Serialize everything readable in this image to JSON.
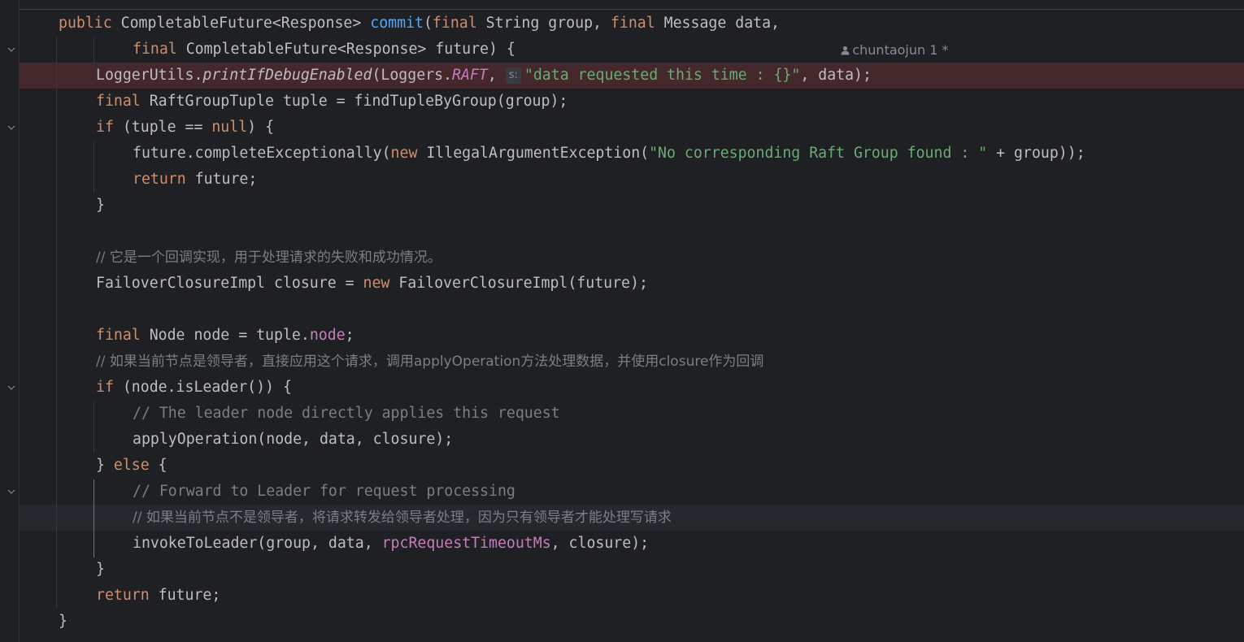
{
  "editor": {
    "author_annotation": "chuntaojun 1 *",
    "param_hint_label": "s:",
    "colors": {
      "background": "#1f2023",
      "keyword": "#cf8e6d",
      "method_declaration": "#56a8f5",
      "string": "#6aab73",
      "field": "#c77dbb",
      "comment": "#7a7e85",
      "breakpoint_line": "#45282b"
    },
    "icons": [
      "chevron-down-icon",
      "user-icon"
    ],
    "lines": [
      {
        "row": "0",
        "tokens": [
          {
            "text": "public ",
            "cls": "kw"
          },
          {
            "text": "CompletableFuture<Response> ",
            "cls": ""
          },
          {
            "text": "commit",
            "cls": "fn"
          },
          {
            "text": "(",
            "cls": ""
          },
          {
            "text": "final ",
            "cls": "kw"
          },
          {
            "text": "String group, ",
            "cls": ""
          },
          {
            "text": "final ",
            "cls": "kw"
          },
          {
            "text": "Message data,",
            "cls": ""
          }
        ]
      },
      {
        "row": "1",
        "tokens": [
          {
            "text": "final ",
            "cls": "kw"
          },
          {
            "text": "CompletableFuture<Response> future) {",
            "cls": ""
          }
        ]
      },
      {
        "row": "2",
        "tokens": [
          {
            "text": "LoggerUtils.",
            "cls": ""
          },
          {
            "text": "printIfDebugEnabled",
            "cls": "smeth"
          },
          {
            "text": "(Loggers.",
            "cls": ""
          },
          {
            "text": "RAFT",
            "cls": "sfld"
          },
          {
            "text": ", ",
            "cls": ""
          },
          {
            "text": "s:",
            "cls": "hint"
          },
          {
            "text": "\"data requested this time : {}\"",
            "cls": "str"
          },
          {
            "text": ", data);",
            "cls": ""
          }
        ]
      },
      {
        "row": "3",
        "tokens": [
          {
            "text": "final ",
            "cls": "kw"
          },
          {
            "text": "RaftGroupTuple tuple = findTupleByGroup(group);",
            "cls": ""
          }
        ]
      },
      {
        "row": "4",
        "tokens": [
          {
            "text": "if ",
            "cls": "kw"
          },
          {
            "text": "(tuple == ",
            "cls": ""
          },
          {
            "text": "null",
            "cls": "kw"
          },
          {
            "text": ") {",
            "cls": ""
          }
        ]
      },
      {
        "row": "5",
        "tokens": [
          {
            "text": "future.completeExceptionally(",
            "cls": ""
          },
          {
            "text": "new ",
            "cls": "kw"
          },
          {
            "text": "IllegalArgumentException(",
            "cls": ""
          },
          {
            "text": "\"No corresponding Raft Group found : \"",
            "cls": "str"
          },
          {
            "text": " + group));",
            "cls": ""
          }
        ]
      },
      {
        "row": "6",
        "tokens": [
          {
            "text": "return ",
            "cls": "kw"
          },
          {
            "text": "future;",
            "cls": ""
          }
        ]
      },
      {
        "row": "7",
        "tokens": [
          {
            "text": "}",
            "cls": ""
          }
        ]
      },
      {
        "row": "9",
        "tokens": [
          {
            "text": "// 它是一个回调实现，用于处理请求的失败和成功情况。",
            "cls": "cmt-cjk"
          }
        ]
      },
      {
        "row": "10",
        "tokens": [
          {
            "text": "FailoverClosureImpl closure = ",
            "cls": ""
          },
          {
            "text": "new ",
            "cls": "kw"
          },
          {
            "text": "FailoverClosureImpl(future);",
            "cls": ""
          }
        ]
      },
      {
        "row": "12",
        "tokens": [
          {
            "text": "final ",
            "cls": "kw"
          },
          {
            "text": "Node node = tuple.",
            "cls": ""
          },
          {
            "text": "node",
            "cls": "fld"
          },
          {
            "text": ";",
            "cls": ""
          }
        ]
      },
      {
        "row": "13",
        "tokens": [
          {
            "text": "// 如果当前节点是领导者，直接应用这个请求，调用applyOperation方法处理数据，并使用closure作为回调",
            "cls": "cmt-cjk"
          }
        ]
      },
      {
        "row": "14",
        "tokens": [
          {
            "text": "if ",
            "cls": "kw"
          },
          {
            "text": "(node.isLeader()) {",
            "cls": ""
          }
        ]
      },
      {
        "row": "15",
        "tokens": [
          {
            "text": "// The leader node directly applies this request",
            "cls": "cmt"
          }
        ]
      },
      {
        "row": "16",
        "tokens": [
          {
            "text": "applyOperation(node, data, closure);",
            "cls": ""
          }
        ]
      },
      {
        "row": "17",
        "tokens": [
          {
            "text": "} ",
            "cls": ""
          },
          {
            "text": "else ",
            "cls": "kw"
          },
          {
            "text": "{",
            "cls": ""
          }
        ]
      },
      {
        "row": "18",
        "tokens": [
          {
            "text": "// Forward to Leader for request processing",
            "cls": "cmt"
          }
        ]
      },
      {
        "row": "19",
        "tokens": [
          {
            "text": "// 如果当前节点不是领导者，将请求转发给领导者处理，因为只有领导者才能处理写请求",
            "cls": "cmt-cjk"
          }
        ]
      },
      {
        "row": "20",
        "tokens": [
          {
            "text": "invokeToLeader(group, data, ",
            "cls": ""
          },
          {
            "text": "rpcRequestTimeoutMs",
            "cls": "fld"
          },
          {
            "text": ", closure);",
            "cls": ""
          }
        ]
      },
      {
        "row": "21",
        "tokens": [
          {
            "text": "}",
            "cls": ""
          }
        ]
      },
      {
        "row": "22",
        "tokens": [
          {
            "text": "return ",
            "cls": "kw"
          },
          {
            "text": "future;",
            "cls": ""
          }
        ]
      },
      {
        "row": "23",
        "tokens": [
          {
            "text": "}",
            "cls": ""
          }
        ]
      }
    ]
  }
}
